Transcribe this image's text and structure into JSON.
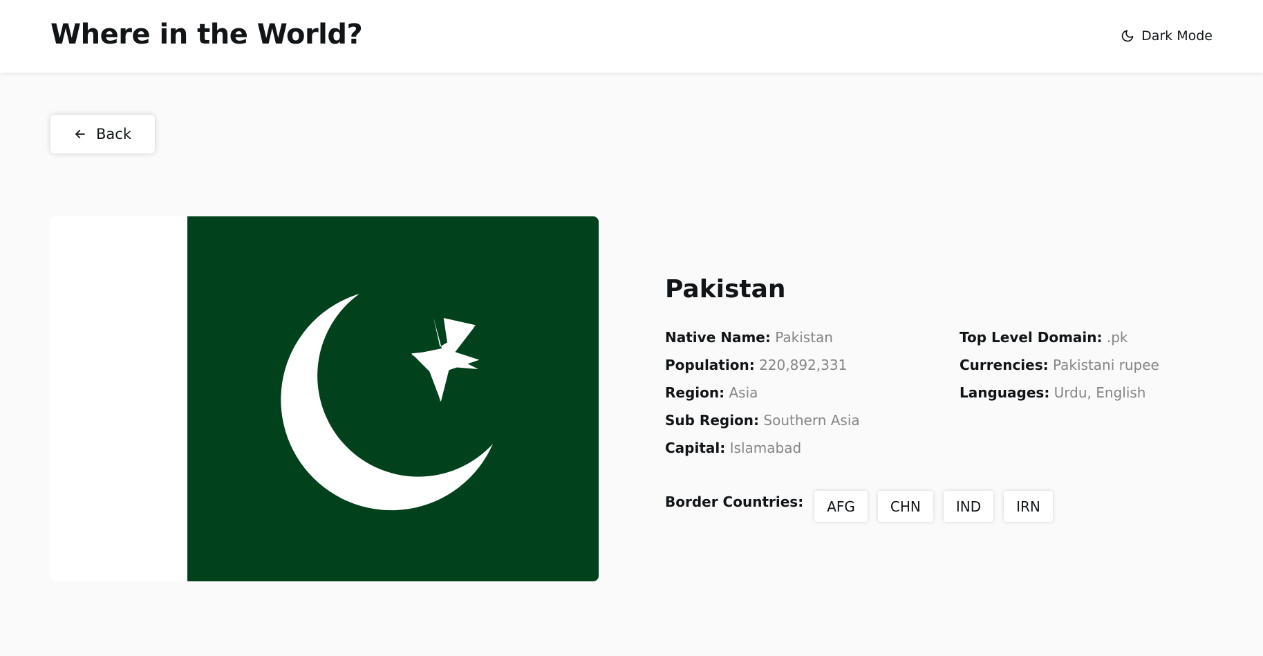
{
  "header": {
    "title": "Where in the World?",
    "theme_toggle_label": "Dark Mode",
    "theme_icon": "moon-icon"
  },
  "back": {
    "label": "Back",
    "icon": "arrow-left-icon"
  },
  "flag": {
    "description_icon": "pakistan-flag",
    "colors": {
      "green": "#01411C",
      "white": "#FFFFFF"
    }
  },
  "country": {
    "name": "Pakistan",
    "left_fields": [
      {
        "label": "Native Name:",
        "value": "Pakistan"
      },
      {
        "label": "Population:",
        "value": "220,892,331"
      },
      {
        "label": "Region:",
        "value": "Asia"
      },
      {
        "label": "Sub Region:",
        "value": "Southern Asia"
      },
      {
        "label": "Capital:",
        "value": "Islamabad"
      }
    ],
    "right_fields": [
      {
        "label": "Top Level Domain:",
        "value": ".pk"
      },
      {
        "label": "Currencies:",
        "value": "Pakistani rupee"
      },
      {
        "label": "Languages:",
        "value": "Urdu, English"
      }
    ],
    "borders_label": "Border Countries:",
    "borders": [
      "AFG",
      "CHN",
      "IND",
      "IRN"
    ]
  },
  "colors": {
    "background": "#FAFAFA",
    "surface": "#FFFFFF",
    "text": "#111517",
    "muted": "#858585"
  }
}
